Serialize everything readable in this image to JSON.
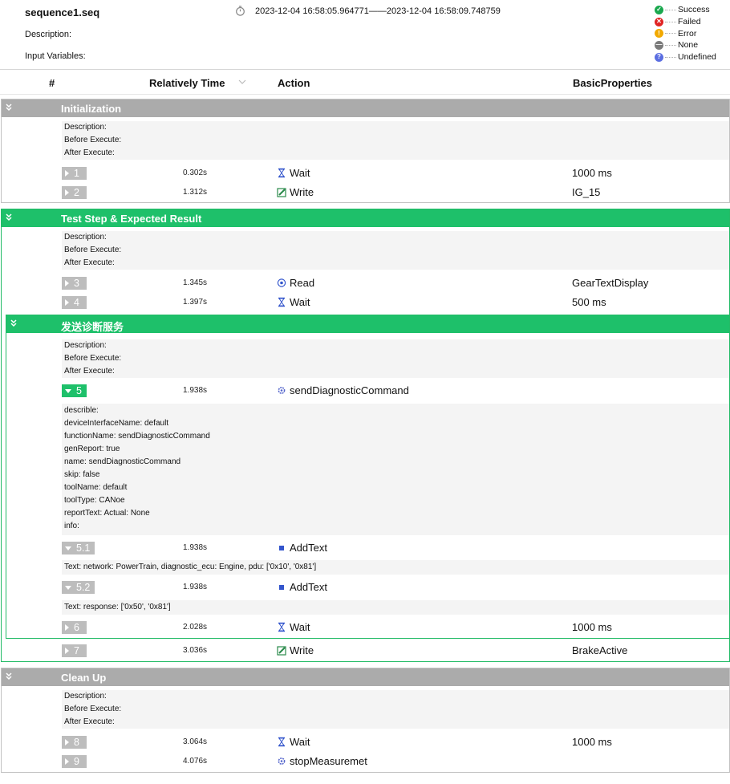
{
  "header": {
    "title": "sequence1.seq",
    "description_label": "Description:",
    "input_variables_label": "Input Variables:",
    "time_range": "2023-12-04 16:58:05.964771——2023-12-04 16:58:09.748759"
  },
  "legend": [
    {
      "label": "Success",
      "color": "#1aa84e",
      "icon": "check-icon"
    },
    {
      "label": "Failed",
      "color": "#e02424",
      "icon": "x-icon"
    },
    {
      "label": "Error",
      "color": "#f2a900",
      "icon": "exclamation-icon"
    },
    {
      "label": "None",
      "color": "#7a7a7a",
      "icon": "minus-icon"
    },
    {
      "label": "Undefined",
      "color": "#5b6ee1",
      "icon": "question-icon"
    }
  ],
  "columns": {
    "num": "#",
    "time": "Relatively Time",
    "action": "Action",
    "props": "BasicProperties"
  },
  "info_labels": {
    "description": "Description:",
    "before": "Before Execute:",
    "after": "After Execute:"
  },
  "groups": {
    "init": {
      "title": "Initialization"
    },
    "test": {
      "title": "Test Step & Expected Result"
    },
    "diag": {
      "title": "发送诊断服务"
    },
    "cleanup": {
      "title": "Clean Up"
    }
  },
  "rows": {
    "r1": {
      "step": "1",
      "time": "0.302s",
      "action": "Wait",
      "icon": "hourglass-icon",
      "prop": "1000 ms"
    },
    "r2": {
      "step": "2",
      "time": "1.312s",
      "action": "Write",
      "icon": "edit-icon",
      "prop": "IG_15"
    },
    "r3": {
      "step": "3",
      "time": "1.345s",
      "action": "Read",
      "icon": "read-icon",
      "prop": "GearTextDisplay"
    },
    "r4": {
      "step": "4",
      "time": "1.397s",
      "action": "Wait",
      "icon": "hourglass-icon",
      "prop": "500 ms"
    },
    "r5": {
      "step": "5",
      "time": "1.938s",
      "action": "sendDiagnosticCommand",
      "icon": "gear-icon",
      "prop": ""
    },
    "r51": {
      "step": "5.1",
      "time": "1.938s",
      "action": "AddText",
      "icon": "square-icon",
      "prop": ""
    },
    "r52": {
      "step": "5.2",
      "time": "1.938s",
      "action": "AddText",
      "icon": "square-icon",
      "prop": ""
    },
    "r6": {
      "step": "6",
      "time": "2.028s",
      "action": "Wait",
      "icon": "hourglass-icon",
      "prop": "1000 ms"
    },
    "r7": {
      "step": "7",
      "time": "3.036s",
      "action": "Write",
      "icon": "edit-icon",
      "prop": "BrakeActive"
    },
    "r8": {
      "step": "8",
      "time": "3.064s",
      "action": "Wait",
      "icon": "hourglass-icon",
      "prop": "1000 ms"
    },
    "r9": {
      "step": "9",
      "time": "4.076s",
      "action": "stopMeasuremet",
      "icon": "gear-icon",
      "prop": ""
    }
  },
  "details5": [
    "describle:",
    "deviceInterfaceName: default",
    "functionName: sendDiagnosticCommand",
    "genReport: true",
    "name: sendDiagnosticCommand",
    "skip: false",
    "toolName: default",
    "toolType: CANoe",
    "reportText:  Actual: None",
    "info:"
  ],
  "text51": "Text: network: PowerTrain, diagnostic_ecu: Engine, pdu: ['0x10', '0x81']",
  "text52": "Text: response: ['0x50', '0x81']"
}
